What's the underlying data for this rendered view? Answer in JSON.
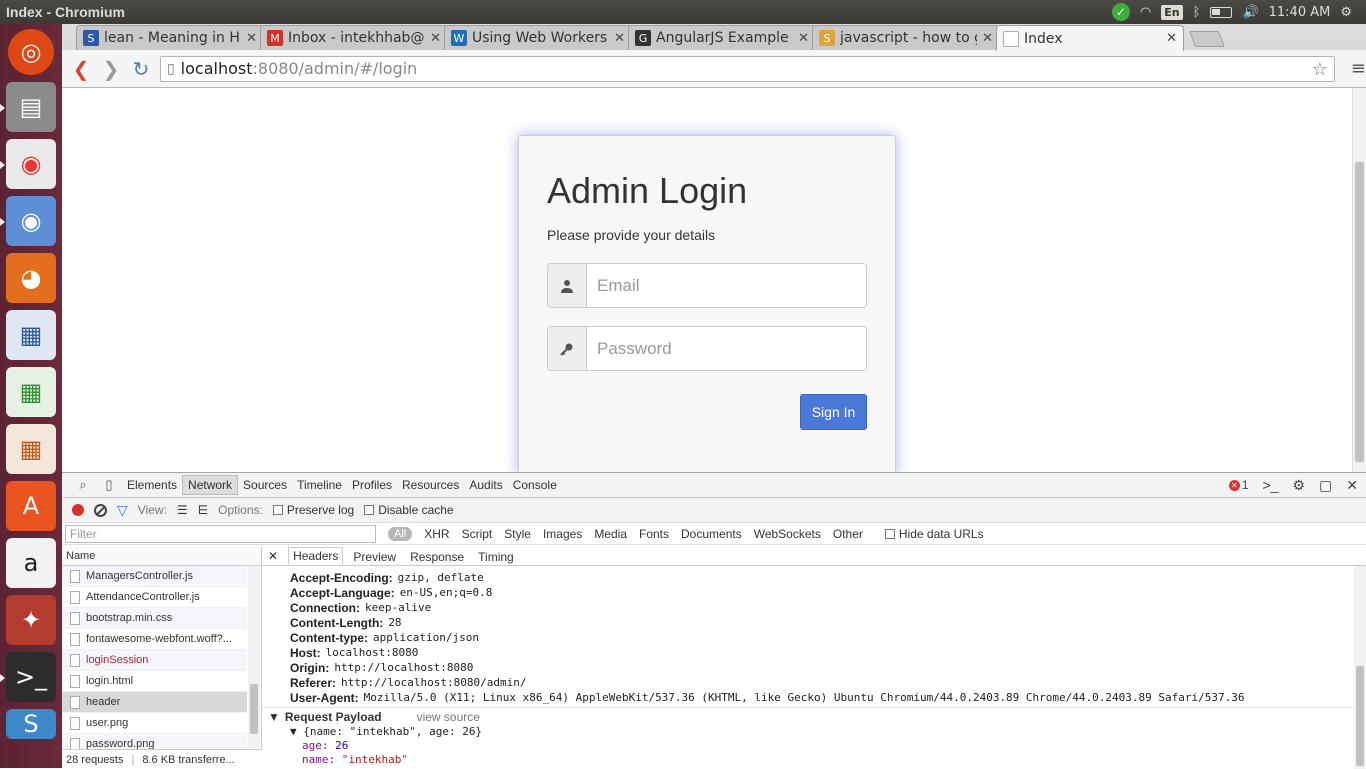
{
  "window": {
    "title": "Index - Chromium",
    "clock": "11:40 AM",
    "keyboard": "En"
  },
  "tabs": [
    {
      "title": "lean - Meaning in Hi",
      "fav": "S",
      "favcolor": "#2b58a8"
    },
    {
      "title": "Inbox - intekhhab@",
      "fav": "M",
      "favcolor": "#d93025"
    },
    {
      "title": "Using Web Workers",
      "fav": "W",
      "favcolor": "#1f6fb5"
    },
    {
      "title": "AngularJS Example",
      "fav": "G",
      "favcolor": "#333333"
    },
    {
      "title": "javascript - how to g",
      "fav": "S",
      "favcolor": "#e2a23b"
    },
    {
      "title": "Index",
      "fav": "",
      "favcolor": "#ffffff"
    }
  ],
  "omnibox": {
    "host": "localhost",
    "path": ":8080/admin/#/login"
  },
  "login": {
    "title": "Admin Login",
    "subtitle": "Please provide your details",
    "email_placeholder": "Email",
    "password_placeholder": "Password",
    "signin_label": "Sign In"
  },
  "devtools": {
    "panels": [
      "Elements",
      "Network",
      "Sources",
      "Timeline",
      "Profiles",
      "Resources",
      "Audits",
      "Console"
    ],
    "error_count": "1",
    "view_label": "View:",
    "options_label": "Options:",
    "preserve_log": "Preserve log",
    "disable_cache": "Disable cache",
    "filter_placeholder": "Filter",
    "types": [
      "All",
      "XHR",
      "Script",
      "Style",
      "Images",
      "Media",
      "Fonts",
      "Documents",
      "WebSockets",
      "Other"
    ],
    "hide_data_urls": "Hide data URLs",
    "name_header": "Name",
    "requests": [
      {
        "name": "ManagersController.js",
        "state": ""
      },
      {
        "name": "AttendanceController.js",
        "state": ""
      },
      {
        "name": "bootstrap.min.css",
        "state": ""
      },
      {
        "name": "fontawesome-webfont.woff?...",
        "state": ""
      },
      {
        "name": "loginSession",
        "state": "err"
      },
      {
        "name": "login.html",
        "state": ""
      },
      {
        "name": "header",
        "state": "sel"
      },
      {
        "name": "user.png",
        "state": ""
      },
      {
        "name": "password.png",
        "state": ""
      }
    ],
    "footer_requests": "28 requests",
    "footer_transferred": "8.6 KB transferre...",
    "detail_tabs": [
      "Headers",
      "Preview",
      "Response",
      "Timing"
    ],
    "headers": [
      {
        "k": "Accept-Encoding:",
        "v": "gzip, deflate"
      },
      {
        "k": "Accept-Language:",
        "v": "en-US,en;q=0.8"
      },
      {
        "k": "Connection:",
        "v": "keep-alive"
      },
      {
        "k": "Content-Length:",
        "v": "28"
      },
      {
        "k": "Content-type:",
        "v": "application/json"
      },
      {
        "k": "Host:",
        "v": "localhost:8080"
      },
      {
        "k": "Origin:",
        "v": "http://localhost:8080"
      },
      {
        "k": "Referer:",
        "v": "http://localhost:8080/admin/"
      },
      {
        "k": "User-Agent:",
        "v": "Mozilla/5.0 (X11; Linux x86_64) AppleWebKit/537.36 (KHTML, like Gecko) Ubuntu Chromium/44.0.2403.89 Chrome/44.0.2403.89 Safari/537.36"
      }
    ],
    "payload_title": "Request Payload",
    "view_source": "view source",
    "payload_summary": "{name: \"intekhab\", age: 26}",
    "payload_age_key": "age:",
    "payload_age_val": "26",
    "payload_name_key": "name:",
    "payload_name_val": "\"intekhab\""
  }
}
